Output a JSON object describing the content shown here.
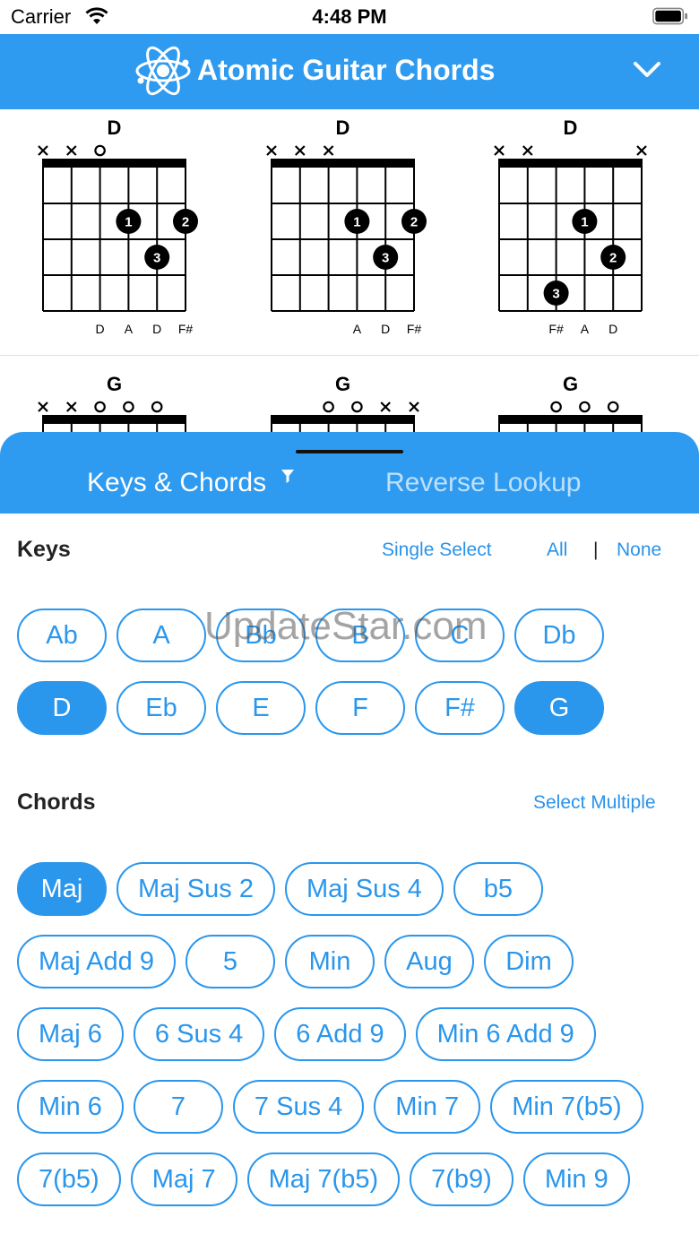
{
  "status": {
    "carrier": "Carrier",
    "time": "4:48 PM"
  },
  "nav": {
    "title": "Atomic Guitar Chords",
    "logo_icon": "atom-icon",
    "dropdown_icon": "chevron-down-icon"
  },
  "chord_diagrams": [
    {
      "name": "D",
      "top": [
        "x",
        "x",
        "o",
        "",
        "",
        ""
      ],
      "dots": [
        {
          "string": 4,
          "fret": 2,
          "finger": "1"
        },
        {
          "string": 6,
          "fret": 2,
          "finger": "2"
        },
        {
          "string": 5,
          "fret": 3,
          "finger": "3"
        }
      ],
      "notes": [
        "",
        "",
        "D",
        "A",
        "D",
        "F#"
      ]
    },
    {
      "name": "D",
      "top": [
        "x",
        "x",
        "x",
        "",
        "",
        ""
      ],
      "dots": [
        {
          "string": 4,
          "fret": 2,
          "finger": "1"
        },
        {
          "string": 6,
          "fret": 2,
          "finger": "2"
        },
        {
          "string": 5,
          "fret": 3,
          "finger": "3"
        }
      ],
      "notes": [
        "",
        "",
        "",
        "A",
        "D",
        "F#"
      ]
    },
    {
      "name": "D",
      "top": [
        "x",
        "x",
        "",
        "",
        "",
        "x"
      ],
      "dots": [
        {
          "string": 4,
          "fret": 2,
          "finger": "1"
        },
        {
          "string": 5,
          "fret": 3,
          "finger": "2"
        },
        {
          "string": 3,
          "fret": 4,
          "finger": "3"
        }
      ],
      "notes": [
        "",
        "",
        "F#",
        "A",
        "D",
        ""
      ]
    },
    {
      "name": "G",
      "top": [
        "x",
        "x",
        "o",
        "o",
        "o",
        ""
      ],
      "dots": [],
      "notes": []
    },
    {
      "name": "G",
      "top": [
        "",
        "",
        "o",
        "o",
        "x",
        "x"
      ],
      "dots": [],
      "notes": []
    },
    {
      "name": "G",
      "top": [
        "",
        "",
        "o",
        "o",
        "o",
        ""
      ],
      "dots": [],
      "notes": []
    }
  ],
  "tabs": {
    "keys_chords": "Keys & Chords",
    "reverse_lookup": "Reverse Lookup",
    "filter_icon": "filter-icon"
  },
  "keys_section": {
    "title": "Keys",
    "single_select": "Single Select",
    "all": "All",
    "separator": "|",
    "none": "None"
  },
  "keys": [
    {
      "label": "Ab",
      "selected": false
    },
    {
      "label": "A",
      "selected": false
    },
    {
      "label": "Bb",
      "selected": false
    },
    {
      "label": "B",
      "selected": false
    },
    {
      "label": "C",
      "selected": false
    },
    {
      "label": "Db",
      "selected": false
    },
    {
      "label": "D",
      "selected": true
    },
    {
      "label": "Eb",
      "selected": false
    },
    {
      "label": "E",
      "selected": false
    },
    {
      "label": "F",
      "selected": false
    },
    {
      "label": "F#",
      "selected": false
    },
    {
      "label": "G",
      "selected": true
    }
  ],
  "chords_section": {
    "title": "Chords",
    "select_multiple": "Select Multiple"
  },
  "chords": [
    {
      "label": "Maj",
      "selected": true
    },
    {
      "label": "Maj Sus 2",
      "selected": false
    },
    {
      "label": "Maj Sus 4",
      "selected": false
    },
    {
      "label": "b5",
      "selected": false
    },
    {
      "label": "Maj Add 9",
      "selected": false
    },
    {
      "label": "5",
      "selected": false
    },
    {
      "label": "Min",
      "selected": false
    },
    {
      "label": "Aug",
      "selected": false
    },
    {
      "label": "Dim",
      "selected": false
    },
    {
      "label": "Maj 6",
      "selected": false
    },
    {
      "label": "6 Sus 4",
      "selected": false
    },
    {
      "label": "6 Add 9",
      "selected": false
    },
    {
      "label": "Min 6 Add 9",
      "selected": false
    },
    {
      "label": "Min 6",
      "selected": false
    },
    {
      "label": "7",
      "selected": false
    },
    {
      "label": "7 Sus 4",
      "selected": false
    },
    {
      "label": "Min 7",
      "selected": false
    },
    {
      "label": "Min 7(b5)",
      "selected": false
    },
    {
      "label": "7(b5)",
      "selected": false
    },
    {
      "label": "Maj 7",
      "selected": false
    },
    {
      "label": "Maj 7(b5)",
      "selected": false
    },
    {
      "label": "7(b9)",
      "selected": false
    },
    {
      "label": "Min 9",
      "selected": false
    }
  ],
  "watermark": "UpdateStar.com",
  "colors": {
    "accent": "#2f9bf0",
    "pill": "#2a96ec"
  }
}
